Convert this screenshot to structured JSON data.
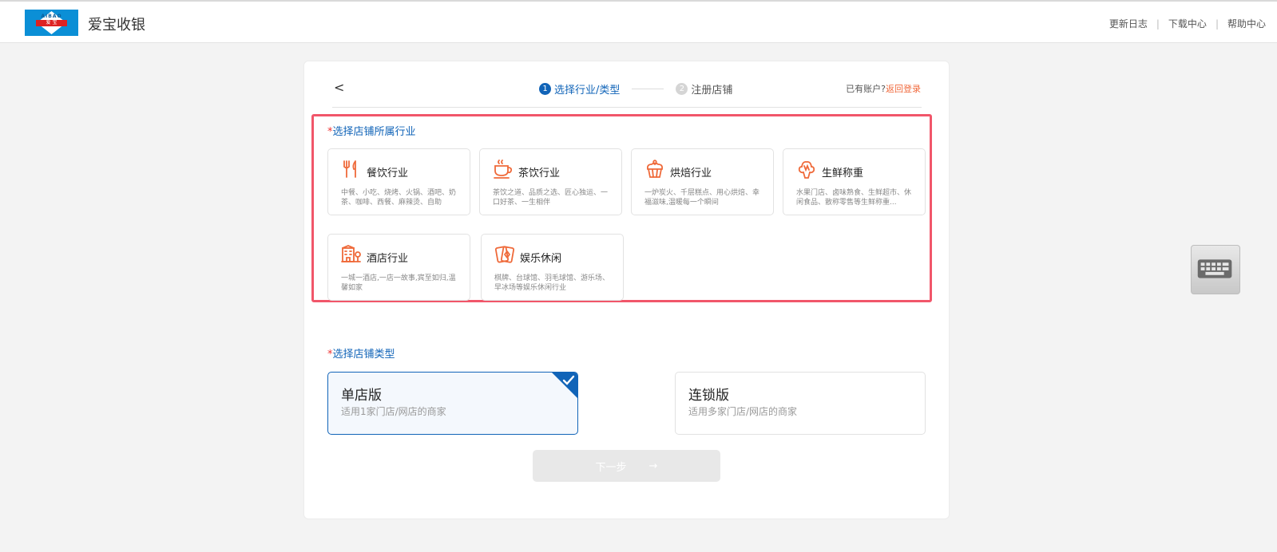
{
  "header": {
    "logo_top": "AIBAO",
    "logo_bar": "爱 宝",
    "brand": "爱宝收银",
    "links": [
      "更新日志",
      "下载中心",
      "帮助中心"
    ],
    "separator": "|"
  },
  "steps": {
    "back": "<",
    "step1_num": "1",
    "step1_label": "选择行业/类型",
    "step2_num": "2",
    "step2_label": "注册店铺"
  },
  "account": {
    "prompt": "已有账户?",
    "login_link": "返回登录"
  },
  "industry": {
    "required_mark": "*",
    "title": "选择店铺所属行业",
    "items": [
      {
        "name": "餐饮行业",
        "desc": "中餐、小吃、烧烤、火锅、酒吧、奶茶、咖啡、西餐、麻辣烫、自助",
        "icon": "fork-knife-icon"
      },
      {
        "name": "茶饮行业",
        "desc": "茶饮之道、品质之选、匠心独运、一口好茶、一生相伴",
        "icon": "teacup-icon"
      },
      {
        "name": "烘焙行业",
        "desc": "一炉炭火、千层糕点、用心烘焙、幸福滋味,温暖每一个瞬间",
        "icon": "cupcake-icon"
      },
      {
        "name": "生鲜称重",
        "desc": "水果门店、卤味熟食、生鲜超市、休闲食品、散称零售等生鲜称重...",
        "icon": "produce-icon"
      },
      {
        "name": "酒店行业",
        "desc": "一城一酒店,一店一故事,宾至如归,温馨如家",
        "icon": "hotel-icon"
      },
      {
        "name": "娱乐休闲",
        "desc": "棋牌、台球馆、羽毛球馆、游乐场、早冰场等娱乐休闲行业",
        "icon": "playing-cards-icon"
      }
    ]
  },
  "store_type": {
    "required_mark": "*",
    "title": "选择店铺类型",
    "options": [
      {
        "name": "单店版",
        "desc": "适用1家门店/网店的商家",
        "selected": true
      },
      {
        "name": "连锁版",
        "desc": "适用多家门店/网店的商家",
        "selected": false
      }
    ]
  },
  "next_button": {
    "label": "下一步",
    "arrow": "→"
  },
  "colors": {
    "accent": "#1164b8",
    "icon_orange": "#ef6a3a",
    "highlight_border": "#f1566a",
    "link": "#f06a3d"
  }
}
